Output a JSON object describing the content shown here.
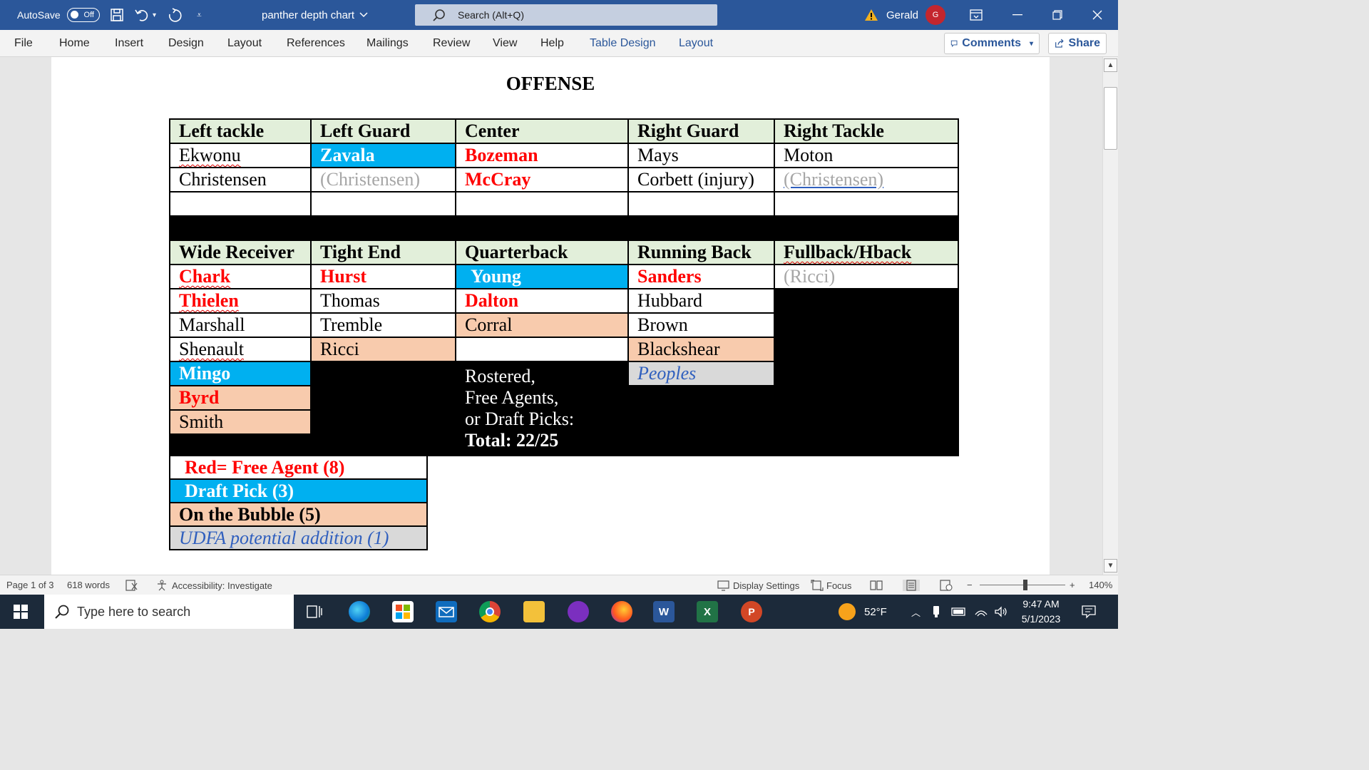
{
  "titlebar": {
    "autosave_label": "AutoSave",
    "autosave_state": "Off",
    "doc_name": "panther depth chart",
    "search_placeholder": "Search (Alt+Q)",
    "user_name": "Gerald",
    "user_initial": "G"
  },
  "ribbon": {
    "tabs": [
      "File",
      "Home",
      "Insert",
      "Design",
      "Layout",
      "References",
      "Mailings",
      "Review",
      "View",
      "Help",
      "Table Design",
      "Layout"
    ],
    "comments_label": "Comments",
    "share_label": "Share"
  },
  "document": {
    "title": "OFFENSE",
    "line_headers": [
      "Left tackle",
      "Left Guard",
      "Center",
      "Right Guard",
      "Right Tackle"
    ],
    "line_rows": [
      [
        "Ekwonu",
        "Zavala",
        "Bozeman",
        "Mays",
        "Moton"
      ],
      [
        "Christensen",
        "(Christensen)",
        "McCray",
        "Corbett (injury)",
        "(Christensen)"
      ]
    ],
    "skill_headers": [
      "Wide Receiver",
      "Tight End",
      "Quarterback",
      "Running Back",
      "Fullback/Hback"
    ],
    "wide_receivers": [
      "Chark",
      "Thielen",
      "Marshall",
      "Shenault",
      "Mingo",
      "Byrd",
      "Smith"
    ],
    "tight_ends": [
      "Hurst",
      "Thomas",
      "Tremble",
      "Ricci"
    ],
    "quarterbacks": [
      "Young",
      "Dalton",
      "Corral"
    ],
    "running_backs": [
      "Sanders",
      "Hubbard",
      "Brown",
      "Blackshear",
      "Peoples"
    ],
    "fullbacks": [
      "(Ricci)"
    ],
    "note_lines": [
      "Rostered,",
      "Free Agents,",
      "or Draft Picks:",
      "Total:  22/25"
    ],
    "legend": [
      "Red= Free Agent  (8)",
      "Draft Pick  (3)",
      "On the Bubble (5)",
      "UDFA potential addition (1)"
    ]
  },
  "statusbar": {
    "page": "Page 1 of 3",
    "words": "618 words",
    "accessibility": "Accessibility: Investigate",
    "display_settings": "Display Settings",
    "focus": "Focus",
    "zoom": "140%"
  },
  "taskbar": {
    "search_placeholder": "Type here to search",
    "temperature": "52°F",
    "time": "9:47 AM",
    "date": "5/1/2023"
  },
  "colors": {
    "title_bar": "#2b579a",
    "header_fill": "#e2efda",
    "free_agent": "#ff0000",
    "draft_pick": "#00b0f0",
    "bubble": "#f8cbad",
    "udfa": "#d9d9d9"
  }
}
